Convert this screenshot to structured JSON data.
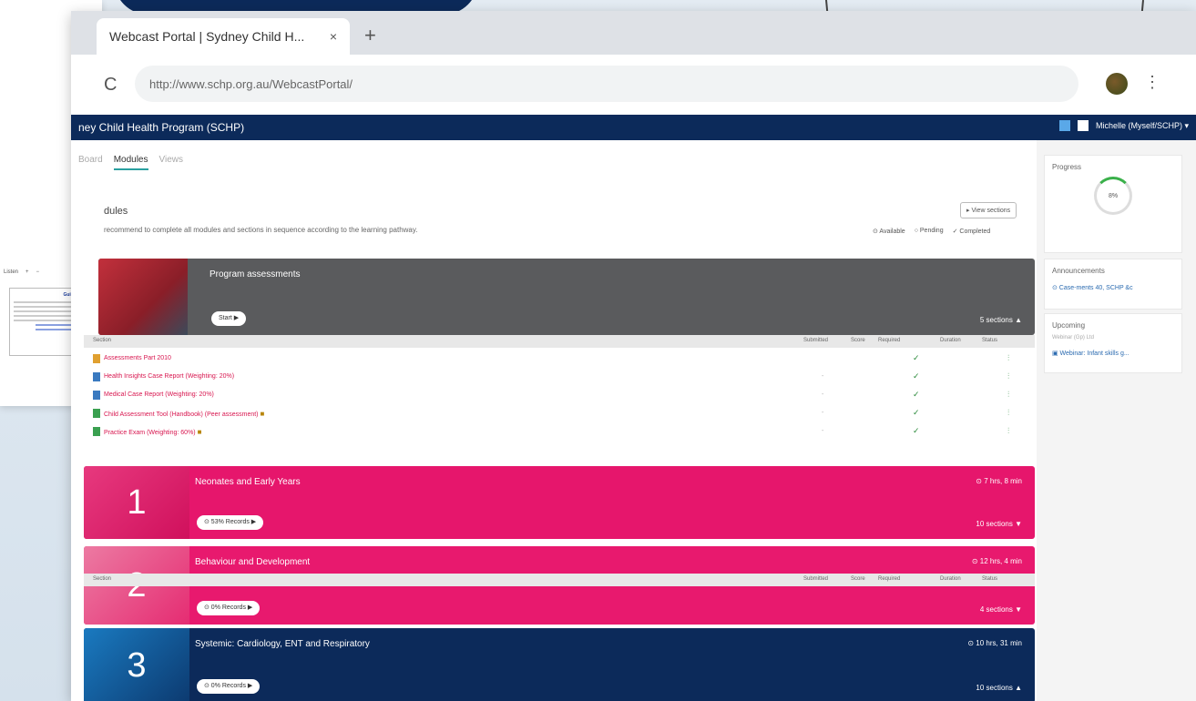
{
  "browser": {
    "tab_title": "Webcast Portal | Sydney Child H...",
    "tab_close": "×",
    "new_tab": "+",
    "reload": "C",
    "url": "http://www.schp.org.au/WebcastPortal/",
    "kebab": "⋮"
  },
  "background_window": {
    "toolbar": [
      "Listen",
      "+",
      "−"
    ],
    "doc_title": "Guidelines"
  },
  "site": {
    "title": "ney Child Health Program (SCHP)",
    "user": "Michelle (Myself/SCHP) ▾"
  },
  "subnav": {
    "items": [
      "Board",
      "Modules",
      "Views"
    ],
    "active": "Modules"
  },
  "section": {
    "title": "dules",
    "note": "recommend to complete all modules and sections in sequence according to the learning pathway.",
    "view_sections": "▸ View sections",
    "legend": [
      "⊙ Available",
      "○ Pending",
      "✓ Completed"
    ]
  },
  "modules": [
    {
      "number": "",
      "title": "Program assessments",
      "pill": "Start ▶",
      "sections": "5 sections ▲",
      "time": ""
    },
    {
      "number": "1",
      "title": "Neonates and Early Years",
      "pill": "⊙ 53% Records ▶",
      "sections": "10 sections ▼",
      "time": "⊙ 7 hrs, 8 min"
    },
    {
      "number": "2",
      "title": "Behaviour and Development",
      "pill": "⊙ 0% Records ▶",
      "sections": "4 sections ▼",
      "time": "⊙ 12 hrs, 4 min"
    },
    {
      "number": "3",
      "title": "Systemic: Cardiology, ENT and Respiratory",
      "pill": "⊙ 0% Records ▶",
      "sections": "10 sections ▲",
      "time": "⊙ 10 hrs, 31 min"
    }
  ],
  "table": {
    "headers": [
      "Section",
      "Submitted",
      "Score",
      "Required",
      "Duration",
      "Status"
    ]
  },
  "activities": [
    {
      "name": "Assessments Part 2010",
      "submitted": "",
      "required": "✓",
      "status": "⫶",
      "locked": false
    },
    {
      "name": "Health Insights Case Report (Weighting: 20%)",
      "submitted": "-",
      "required": "✓",
      "status": "⫶",
      "locked": false
    },
    {
      "name": "Medical Case Report (Weighting: 20%)",
      "submitted": "-",
      "required": "✓",
      "status": "⫶",
      "locked": false
    },
    {
      "name": "Child Assessment Tool (Handbook) (Peer assessment)",
      "submitted": "-",
      "required": "✓",
      "status": "⫶",
      "locked": true
    },
    {
      "name": "Practice Exam (Weighting: 60%)",
      "submitted": "-",
      "required": "✓",
      "status": "⫶",
      "locked": true
    }
  ],
  "sidebar": {
    "progress_title": "Progress",
    "progress_value": "8%",
    "announcements_title": "Announcements",
    "announcement_link": "⊙ Case-ments 40, SCHP &c",
    "upcoming_title": "Upcoming",
    "upcoming_sub": "Webinar (Gp) Ltd",
    "upcoming_link": "▣ Webinar: Infant skills g..."
  },
  "colors": {
    "navy": "#0c2a5a",
    "magenta": "#e6166c",
    "gray": "#5a5b5d"
  }
}
